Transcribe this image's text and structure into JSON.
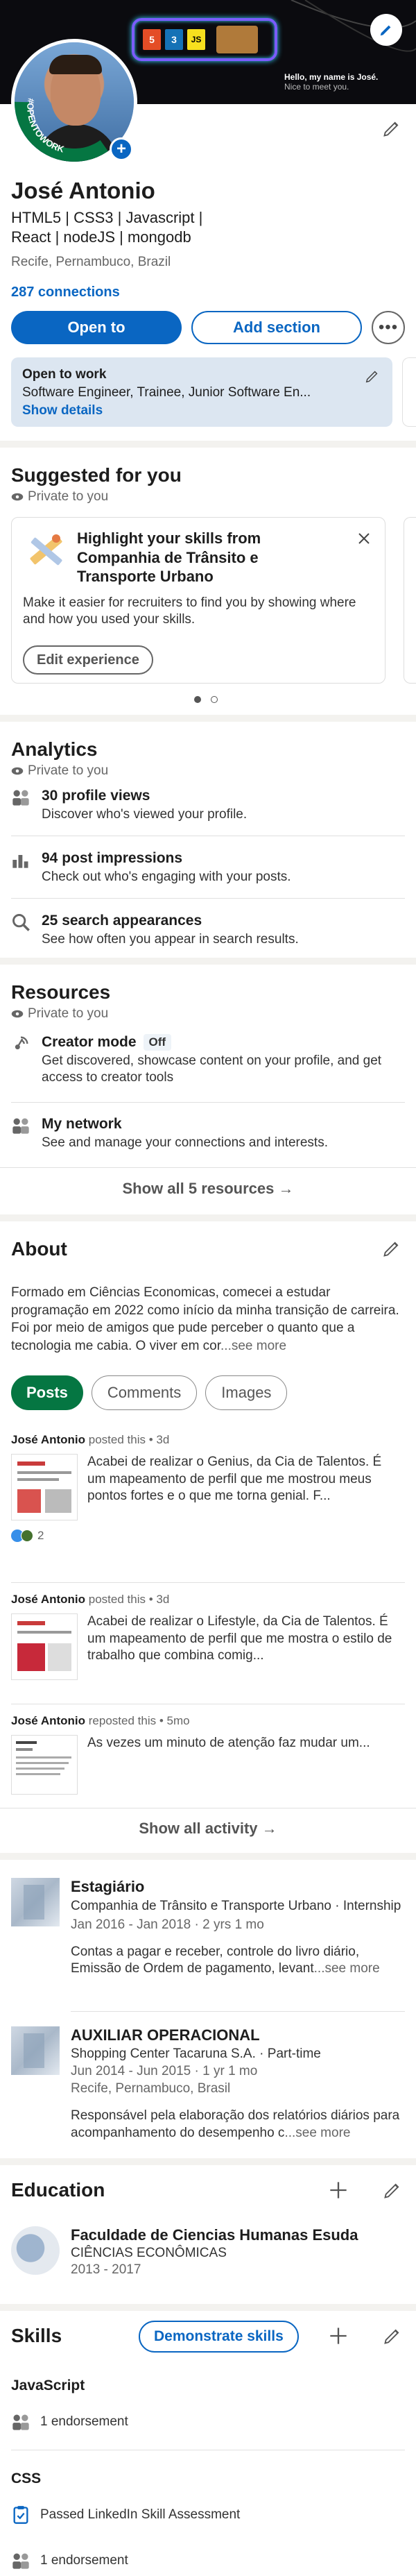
{
  "banner": {
    "hello_line1": "Hello, my name is José.",
    "hello_line2": "Nice to meet you.",
    "tech_badges": [
      "5",
      "3",
      "JS"
    ]
  },
  "profile": {
    "open_to_work_ring": "#OPENTOWORK",
    "name": "José Antonio",
    "headline": "HTML5 | CSS3 | Javascript | React | nodeJS | mongodb",
    "location": "Recife, Pernambuco, Brazil",
    "connections": "287 connections",
    "open_to_button": "Open to",
    "add_section_button": "Add section",
    "open_to_work_title": "Open to work",
    "open_to_work_roles": "Software Engineer, Trainee, Junior Software En...",
    "show_details": "Show details"
  },
  "suggested": {
    "title": "Suggested for you",
    "private": "Private to you",
    "card_title": "Highlight your skills from Companhia de Trânsito e Transporte Urbano",
    "card_body": "Make it easier for recruiters to find you by showing where and how you used your skills.",
    "card_button": "Edit experience"
  },
  "analytics": {
    "title": "Analytics",
    "private": "Private to you",
    "items": [
      {
        "icon": "people-icon",
        "title": "30 profile views",
        "sub": "Discover who's viewed your profile."
      },
      {
        "icon": "bar-chart-icon",
        "title": "94 post impressions",
        "sub": "Check out who's engaging with your posts."
      },
      {
        "icon": "search-icon",
        "title": "25 search appearances",
        "sub": "See how often you appear in search results."
      }
    ]
  },
  "resources": {
    "title": "Resources",
    "private": "Private to you",
    "creator_title": "Creator mode",
    "creator_badge": "Off",
    "creator_sub": "Get discovered, showcase content on your profile, and get access to creator tools",
    "network_title": "My network",
    "network_sub": "See and manage your connections and interests.",
    "show_all": "Show all 5 resources →"
  },
  "about": {
    "title": "About",
    "text": "Formado em Ciências Economicas, comecei a estudar programação em 2022 como início da minha transição de carreira. Foi por meio de amigos que pude perceber o quanto que a tecnologia me cabia. O viver em cor",
    "see_more": "...see more"
  },
  "activity": {
    "tabs": [
      "Posts",
      "Comments",
      "Images"
    ],
    "posts": [
      {
        "author": "José Antonio",
        "action": " posted this • 3d",
        "text": "Acabei de realizar o Genius, da Cia de Talentos. É um mapeamento de perfil que me mostrou meus pontos fortes e o que me torna genial. F...",
        "reactions": "2"
      },
      {
        "author": "José Antonio",
        "action": " posted this • 3d",
        "text": "Acabei de realizar o Lifestyle, da Cia de Talentos. É um mapeamento de perfil que me mostra o estilo de trabalho que combina comig...",
        "reactions": ""
      },
      {
        "author": "José Antonio",
        "action": " reposted this • 5mo",
        "text": "As vezes um minuto de atenção faz mudar um...",
        "reactions": ""
      }
    ],
    "show_all": "Show all activity →"
  },
  "experience": {
    "items": [
      {
        "title": "Estagiário",
        "company": "Companhia de Trânsito e Transporte Urbano · Internship",
        "dates": "Jan 2016 - Jan 2018 · 2 yrs 1 mo",
        "location": "",
        "desc": "Contas a pagar e receber, controle do livro diário, Emissão de Ordem de pagamento, levant",
        "see_more": "...see more"
      },
      {
        "title": "AUXILIAR OPERACIONAL",
        "company": "Shopping Center Tacaruna S.A. · Part-time",
        "dates": "Jun 2014 - Jun 2015 · 1 yr 1 mo",
        "location": "Recife, Pernambuco, Brasil",
        "desc": "Responsável pela elaboração dos relatórios diários para acompanhamento do desempenho c",
        "see_more": "...see more"
      }
    ]
  },
  "education": {
    "title": "Education",
    "school": "Faculdade de Ciencias Humanas Esuda",
    "degree": "CIÊNCIAS ECONÔMICAS",
    "years": "2013 - 2017"
  },
  "skills": {
    "title": "Skills",
    "demonstrate_button": "Demonstrate skills",
    "items": [
      {
        "name": "JavaScript",
        "details": [
          {
            "icon": "people-icon",
            "text": "1 endorsement"
          }
        ]
      },
      {
        "name": "CSS",
        "details": [
          {
            "icon": "assessment-check-icon",
            "text": "Passed LinkedIn Skill Assessment"
          },
          {
            "icon": "people-icon",
            "text": "1 endorsement"
          }
        ]
      }
    ]
  },
  "colors": {
    "brand_blue": "#0a66c2",
    "open_to_work_green": "#057642",
    "open_to_work_bg": "#dce6f1"
  }
}
